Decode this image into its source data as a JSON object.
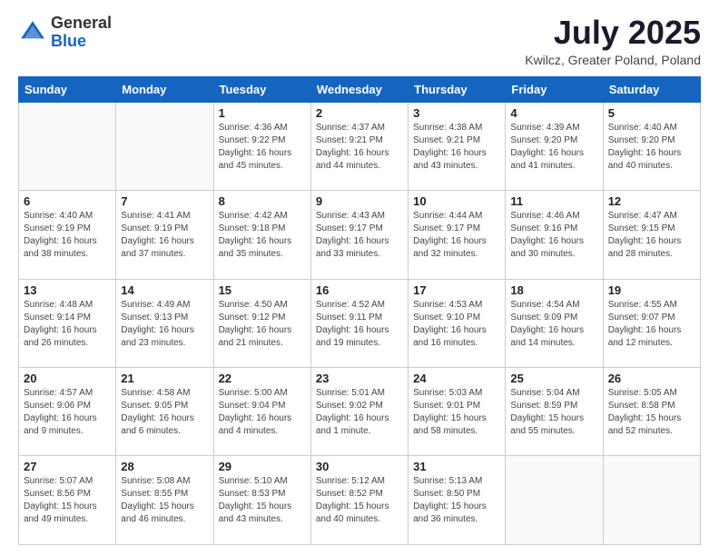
{
  "header": {
    "logo_general": "General",
    "logo_blue": "Blue",
    "month_title": "July 2025",
    "location": "Kwilcz, Greater Poland, Poland"
  },
  "days_of_week": [
    "Sunday",
    "Monday",
    "Tuesday",
    "Wednesday",
    "Thursday",
    "Friday",
    "Saturday"
  ],
  "weeks": [
    [
      {
        "num": "",
        "info": ""
      },
      {
        "num": "",
        "info": ""
      },
      {
        "num": "1",
        "info": "Sunrise: 4:36 AM\nSunset: 9:22 PM\nDaylight: 16 hours and 45 minutes."
      },
      {
        "num": "2",
        "info": "Sunrise: 4:37 AM\nSunset: 9:21 PM\nDaylight: 16 hours and 44 minutes."
      },
      {
        "num": "3",
        "info": "Sunrise: 4:38 AM\nSunset: 9:21 PM\nDaylight: 16 hours and 43 minutes."
      },
      {
        "num": "4",
        "info": "Sunrise: 4:39 AM\nSunset: 9:20 PM\nDaylight: 16 hours and 41 minutes."
      },
      {
        "num": "5",
        "info": "Sunrise: 4:40 AM\nSunset: 9:20 PM\nDaylight: 16 hours and 40 minutes."
      }
    ],
    [
      {
        "num": "6",
        "info": "Sunrise: 4:40 AM\nSunset: 9:19 PM\nDaylight: 16 hours and 38 minutes."
      },
      {
        "num": "7",
        "info": "Sunrise: 4:41 AM\nSunset: 9:19 PM\nDaylight: 16 hours and 37 minutes."
      },
      {
        "num": "8",
        "info": "Sunrise: 4:42 AM\nSunset: 9:18 PM\nDaylight: 16 hours and 35 minutes."
      },
      {
        "num": "9",
        "info": "Sunrise: 4:43 AM\nSunset: 9:17 PM\nDaylight: 16 hours and 33 minutes."
      },
      {
        "num": "10",
        "info": "Sunrise: 4:44 AM\nSunset: 9:17 PM\nDaylight: 16 hours and 32 minutes."
      },
      {
        "num": "11",
        "info": "Sunrise: 4:46 AM\nSunset: 9:16 PM\nDaylight: 16 hours and 30 minutes."
      },
      {
        "num": "12",
        "info": "Sunrise: 4:47 AM\nSunset: 9:15 PM\nDaylight: 16 hours and 28 minutes."
      }
    ],
    [
      {
        "num": "13",
        "info": "Sunrise: 4:48 AM\nSunset: 9:14 PM\nDaylight: 16 hours and 26 minutes."
      },
      {
        "num": "14",
        "info": "Sunrise: 4:49 AM\nSunset: 9:13 PM\nDaylight: 16 hours and 23 minutes."
      },
      {
        "num": "15",
        "info": "Sunrise: 4:50 AM\nSunset: 9:12 PM\nDaylight: 16 hours and 21 minutes."
      },
      {
        "num": "16",
        "info": "Sunrise: 4:52 AM\nSunset: 9:11 PM\nDaylight: 16 hours and 19 minutes."
      },
      {
        "num": "17",
        "info": "Sunrise: 4:53 AM\nSunset: 9:10 PM\nDaylight: 16 hours and 16 minutes."
      },
      {
        "num": "18",
        "info": "Sunrise: 4:54 AM\nSunset: 9:09 PM\nDaylight: 16 hours and 14 minutes."
      },
      {
        "num": "19",
        "info": "Sunrise: 4:55 AM\nSunset: 9:07 PM\nDaylight: 16 hours and 12 minutes."
      }
    ],
    [
      {
        "num": "20",
        "info": "Sunrise: 4:57 AM\nSunset: 9:06 PM\nDaylight: 16 hours and 9 minutes."
      },
      {
        "num": "21",
        "info": "Sunrise: 4:58 AM\nSunset: 9:05 PM\nDaylight: 16 hours and 6 minutes."
      },
      {
        "num": "22",
        "info": "Sunrise: 5:00 AM\nSunset: 9:04 PM\nDaylight: 16 hours and 4 minutes."
      },
      {
        "num": "23",
        "info": "Sunrise: 5:01 AM\nSunset: 9:02 PM\nDaylight: 16 hours and 1 minute."
      },
      {
        "num": "24",
        "info": "Sunrise: 5:03 AM\nSunset: 9:01 PM\nDaylight: 15 hours and 58 minutes."
      },
      {
        "num": "25",
        "info": "Sunrise: 5:04 AM\nSunset: 8:59 PM\nDaylight: 15 hours and 55 minutes."
      },
      {
        "num": "26",
        "info": "Sunrise: 5:05 AM\nSunset: 8:58 PM\nDaylight: 15 hours and 52 minutes."
      }
    ],
    [
      {
        "num": "27",
        "info": "Sunrise: 5:07 AM\nSunset: 8:56 PM\nDaylight: 15 hours and 49 minutes."
      },
      {
        "num": "28",
        "info": "Sunrise: 5:08 AM\nSunset: 8:55 PM\nDaylight: 15 hours and 46 minutes."
      },
      {
        "num": "29",
        "info": "Sunrise: 5:10 AM\nSunset: 8:53 PM\nDaylight: 15 hours and 43 minutes."
      },
      {
        "num": "30",
        "info": "Sunrise: 5:12 AM\nSunset: 8:52 PM\nDaylight: 15 hours and 40 minutes."
      },
      {
        "num": "31",
        "info": "Sunrise: 5:13 AM\nSunset: 8:50 PM\nDaylight: 15 hours and 36 minutes."
      },
      {
        "num": "",
        "info": ""
      },
      {
        "num": "",
        "info": ""
      }
    ]
  ]
}
